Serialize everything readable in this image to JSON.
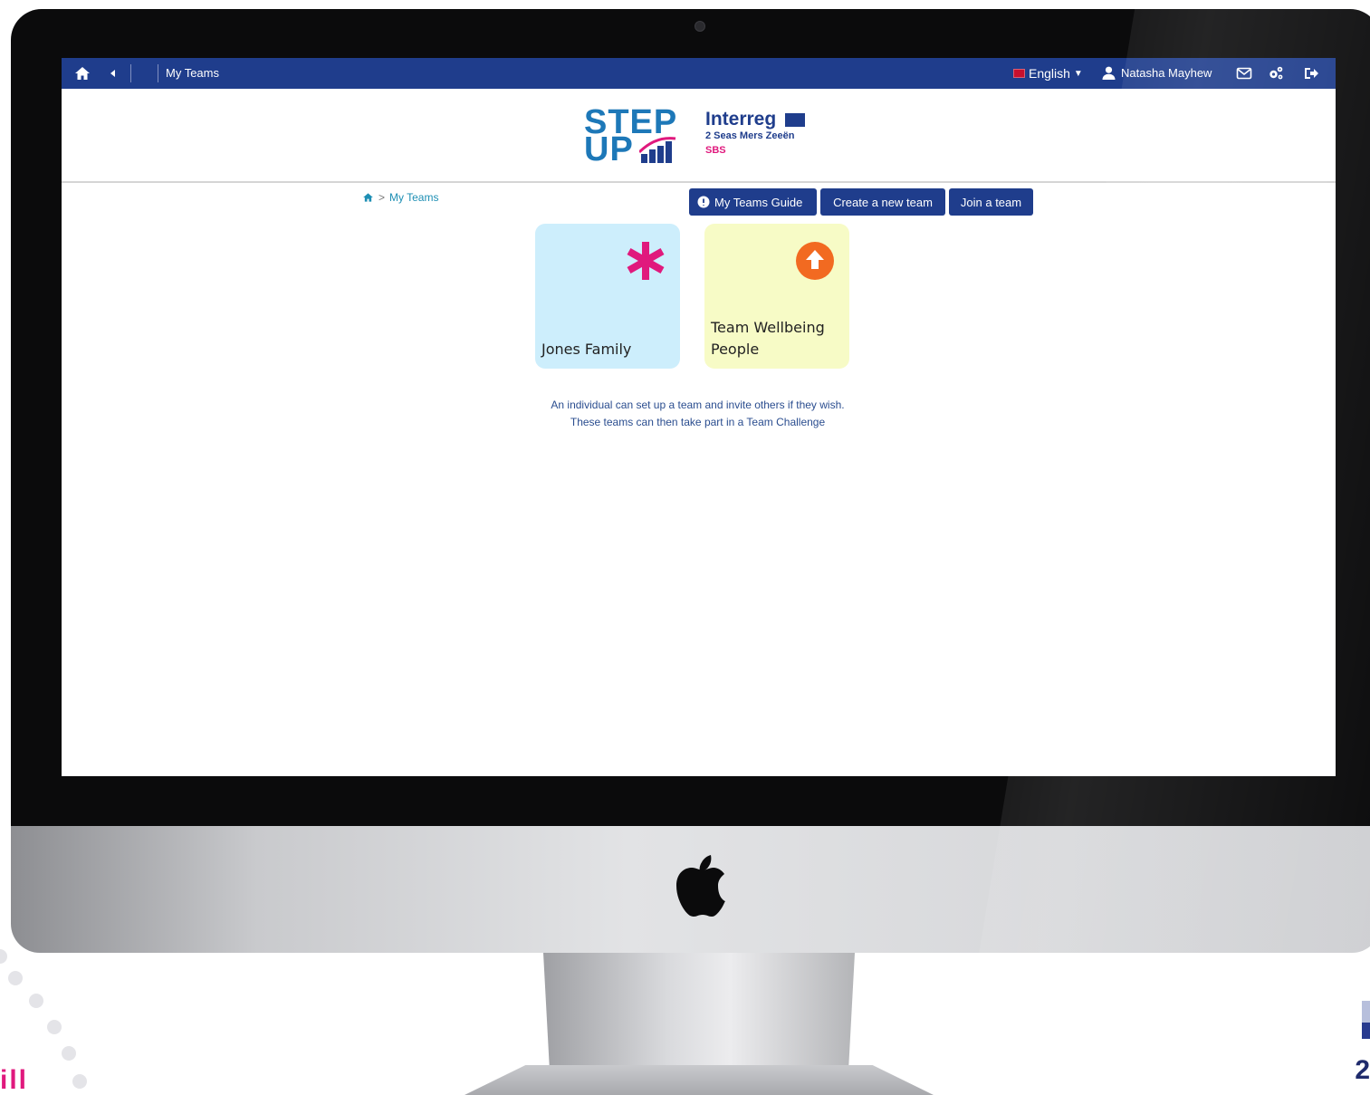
{
  "topbar": {
    "title": "My Teams",
    "language": "English",
    "user_name": "Natasha Mayhew"
  },
  "logo": {
    "step_up_line1": "STEP",
    "step_up_line2": "UP",
    "interreg_name": "Interreg",
    "interreg_sub": "2 Seas Mers Zeeën",
    "interreg_sbs": "SBS"
  },
  "breadcrumb": {
    "separator": ">",
    "current": "My Teams"
  },
  "actions": {
    "guide_label": "My Teams Guide",
    "create_label": "Create a new team",
    "join_label": "Join a team"
  },
  "teams": [
    {
      "name": "Jones Family",
      "color": "#cdeefc",
      "icon": "asterisk-icon",
      "icon_color": "#e0197d"
    },
    {
      "name": "Team Wellbeing People",
      "color": "#f7fbc6",
      "icon": "arrow-up-circle-icon",
      "icon_color": "#f26a21"
    }
  ],
  "info": {
    "line1": "An individual can set up a team and invite others if they wish.",
    "line2": "These teams can then take part in a Team Challenge"
  },
  "colors": {
    "nav_blue": "#1f3d8c",
    "link_teal": "#1e8fb4",
    "accent_pink": "#e0197d"
  }
}
